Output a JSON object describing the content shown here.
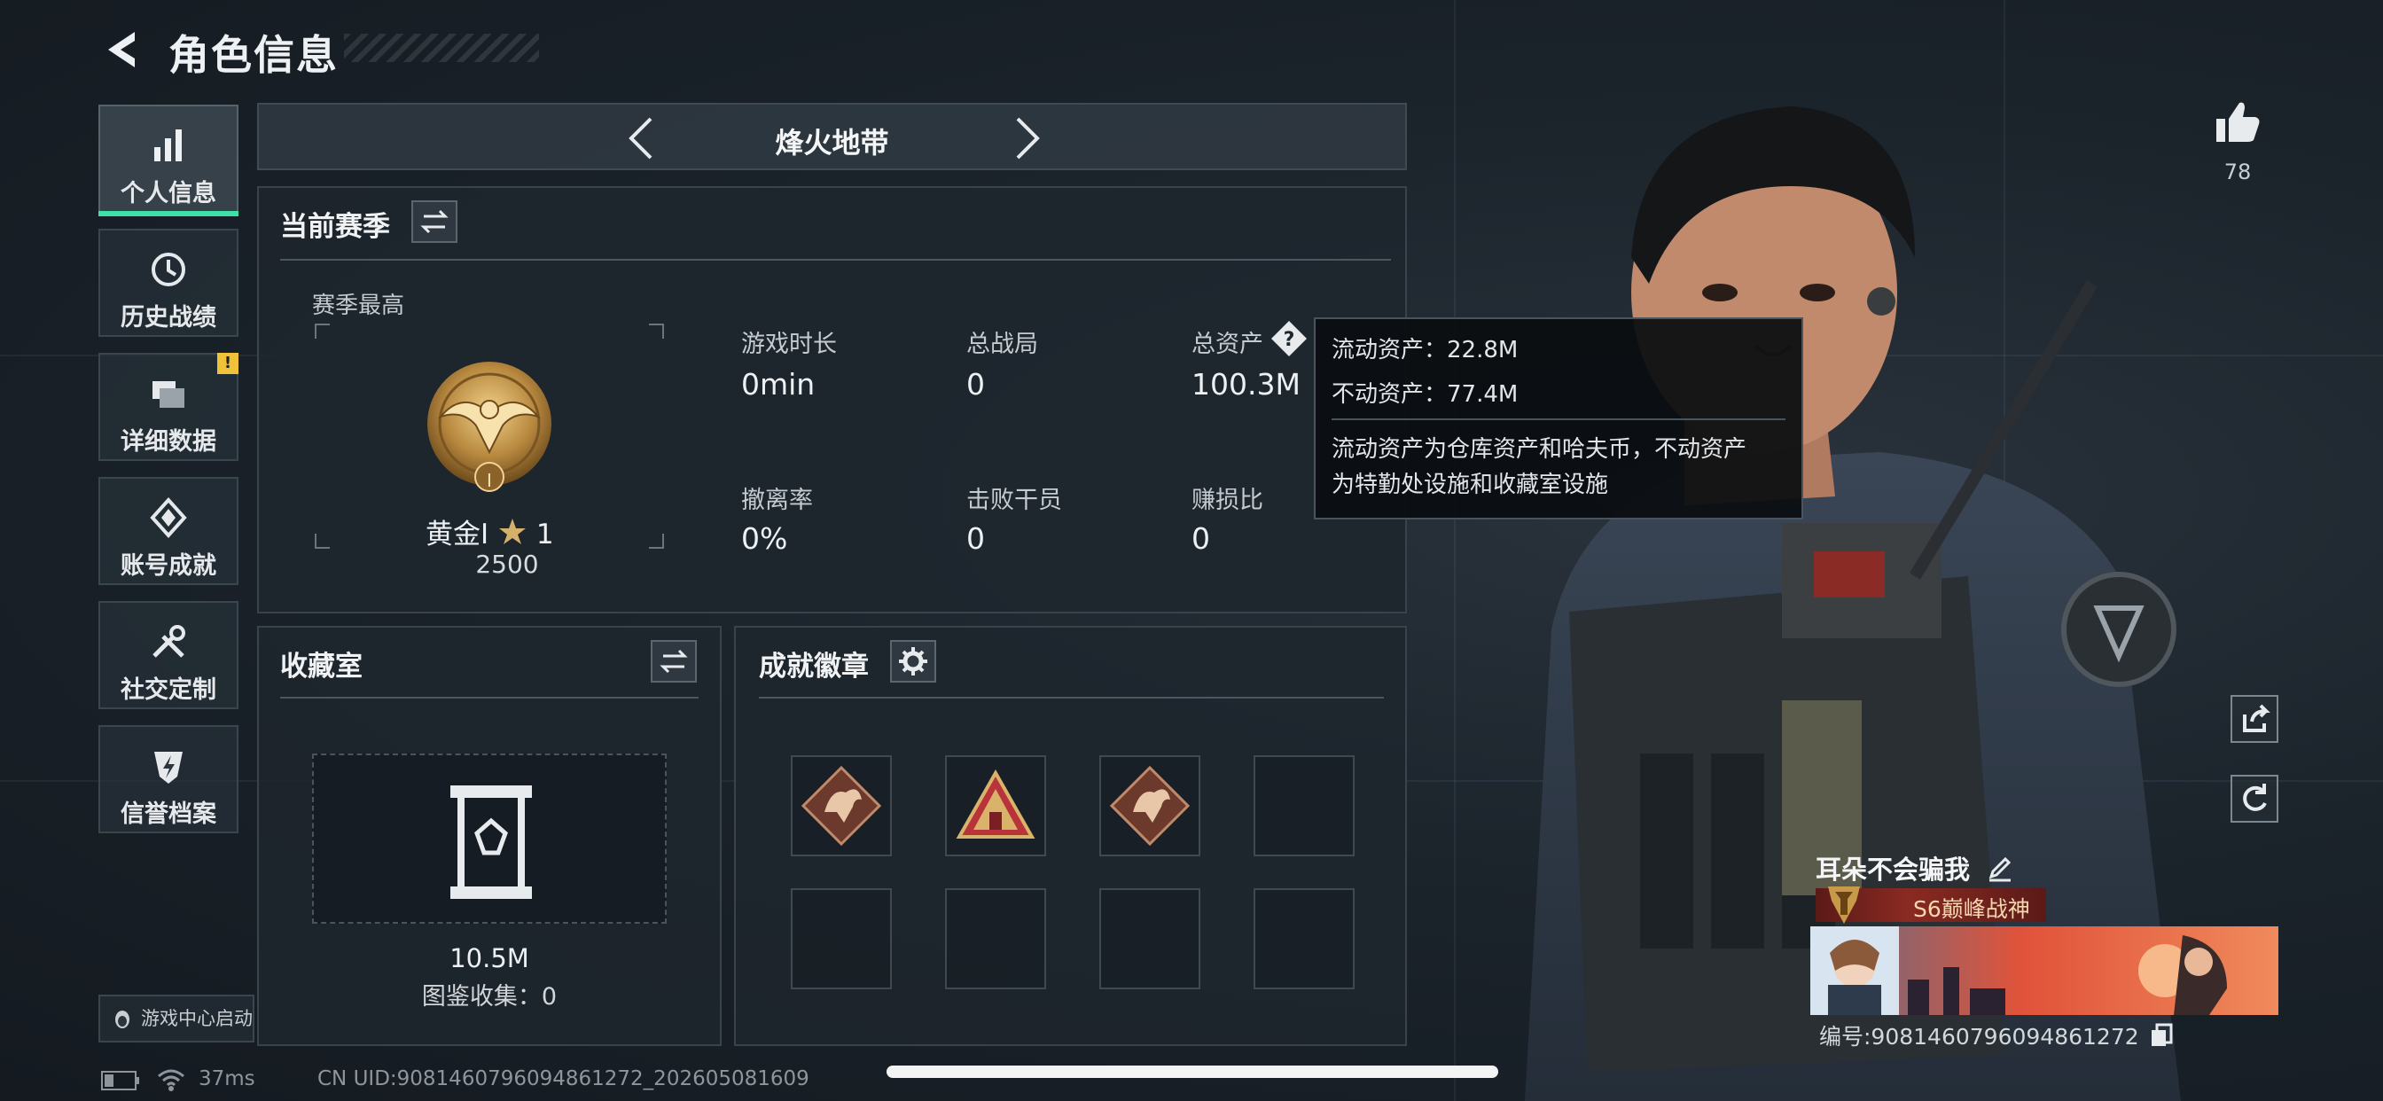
{
  "header": {
    "title": "角色信息"
  },
  "nav": {
    "items": [
      {
        "label": "个人信息",
        "icon": "bar-chart-icon"
      },
      {
        "label": "历史战绩",
        "icon": "history-clock-icon"
      },
      {
        "label": "详细数据",
        "icon": "folder-icon",
        "badge": "!"
      },
      {
        "label": "账号成就",
        "icon": "achievement-icon"
      },
      {
        "label": "社交定制",
        "icon": "tools-icon"
      },
      {
        "label": "信誉档案",
        "icon": "shield-lightning-icon"
      }
    ],
    "launch_label": "游戏中心启动"
  },
  "mode": {
    "title": "烽火地带"
  },
  "season": {
    "title": "当前赛季",
    "best_label": "赛季最高",
    "rank_name": "黄金Ⅰ",
    "rank_stars": "1",
    "rank_points": "2500",
    "medal_numeral": "I",
    "stats": [
      {
        "label": "游戏时长",
        "value": "0min"
      },
      {
        "label": "总战局",
        "value": "0"
      },
      {
        "label": "总资产",
        "value": "100.3M"
      },
      {
        "label": "撤离率",
        "value": "0%"
      },
      {
        "label": "击败干员",
        "value": "0"
      },
      {
        "label": "赚损比",
        "value": "0"
      }
    ]
  },
  "tooltip": {
    "liquid": "流动资产：22.8M",
    "fixed": "不动资产：77.4M",
    "desc_line1": "流动资产为仓库资产和哈夫币，不动资产",
    "desc_line2": "为特勤处设施和收藏室设施"
  },
  "collection": {
    "title": "收藏室",
    "value": "10.5M",
    "catalog": "图鉴收集：0"
  },
  "achievements": {
    "title": "成就徽章",
    "badges": [
      "dragon-badge",
      "pyramid-badge",
      "dragon-badge",
      "",
      "",
      "",
      "",
      ""
    ]
  },
  "profile": {
    "likes": "78",
    "player_name": "耳朵不会骗我",
    "rank_title": "S6巅峰战神",
    "uid_label": "编号:9081460796094861272"
  },
  "status": {
    "ping": "37ms",
    "uid_footer": "CN UID:9081460796094861272_202605081609"
  },
  "colors": {
    "accent": "#3ee0a8",
    "gold": "#c9a45a",
    "warning": "#f0c23a"
  }
}
